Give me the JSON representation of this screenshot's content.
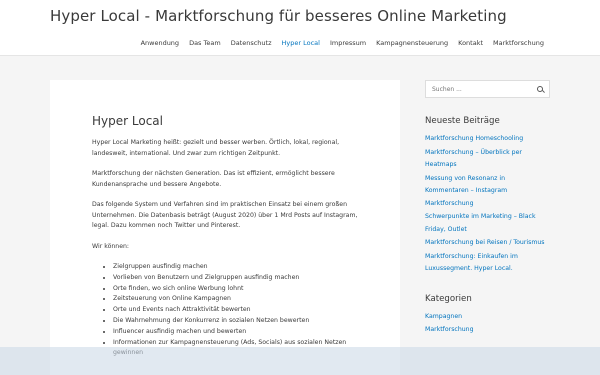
{
  "header": {
    "site_title": "Hyper Local - Marktforschung für besseres Online Marketing",
    "nav": [
      {
        "label": "Anwendung"
      },
      {
        "label": "Das Team"
      },
      {
        "label": "Datenschutz"
      },
      {
        "label": "Hyper Local"
      },
      {
        "label": "Impressum"
      },
      {
        "label": "Kampagnensteuerung"
      },
      {
        "label": "Kontakt"
      },
      {
        "label": "Marktforschung"
      }
    ],
    "active_nav": "Hyper Local"
  },
  "content": {
    "title": "Hyper Local",
    "paragraphs": [
      "Hyper Local Marketing heißt: gezielt und besser werben. Örtlich, lokal, regional, landesweit, international. Und zwar zum richtigen Zeitpunkt.",
      "Marktforschung der nächsten Generation. Das ist effizient, ermöglicht bessere Kundenansprache und bessere Angebote.",
      "Das folgende System und Verfahren sind im praktischen Einsatz bei einem großen Unternehmen. Die Datenbasis beträgt (August 2020) über 1 Mrd Posts auf Instagram, legal. Dazu kommen noch Twitter und Pinterest.",
      "Wir können:"
    ],
    "list": [
      "Zielgruppen ausfindig machen",
      "Vorlieben von Benutzern und Zielgruppen ausfindig machen",
      "Orte finden, wo sich online Werbung lohnt",
      "Zeitsteuerung von Online Kampagnen",
      "Orte und Events nach Attraktivität bewerten",
      "Die Wahrnehmung der Konkurrenz in sozialen Netzen bewerten",
      "Influencer ausfindig machen und bewerten",
      "Informationen zur Kampagnensteuerung (Ads, Socials) aus sozialen Netzen gewinnen"
    ]
  },
  "sidebar": {
    "search_placeholder": "Suchen ...",
    "recent_title": "Neueste Beiträge",
    "recent_posts": [
      "Marktforschung Homeschooling",
      "Marktforschung – Überblick per Heatmaps",
      "Messung von Resonanz in Kommentaren – Instagram Marktforschung",
      "Schwerpunkte im Marketing – Black Friday, Outlet",
      "Marktforschung bei Reisen / Tourismus",
      "Marktforschung: Einkaufen im Luxussegment. Hyper Local."
    ],
    "categories_title": "Kategorien",
    "categories": [
      "Kampagnen",
      "Marktforschung"
    ]
  },
  "colors": {
    "link": "#0274be",
    "text": "#3a3a3a",
    "background": "#f5f5f5"
  }
}
